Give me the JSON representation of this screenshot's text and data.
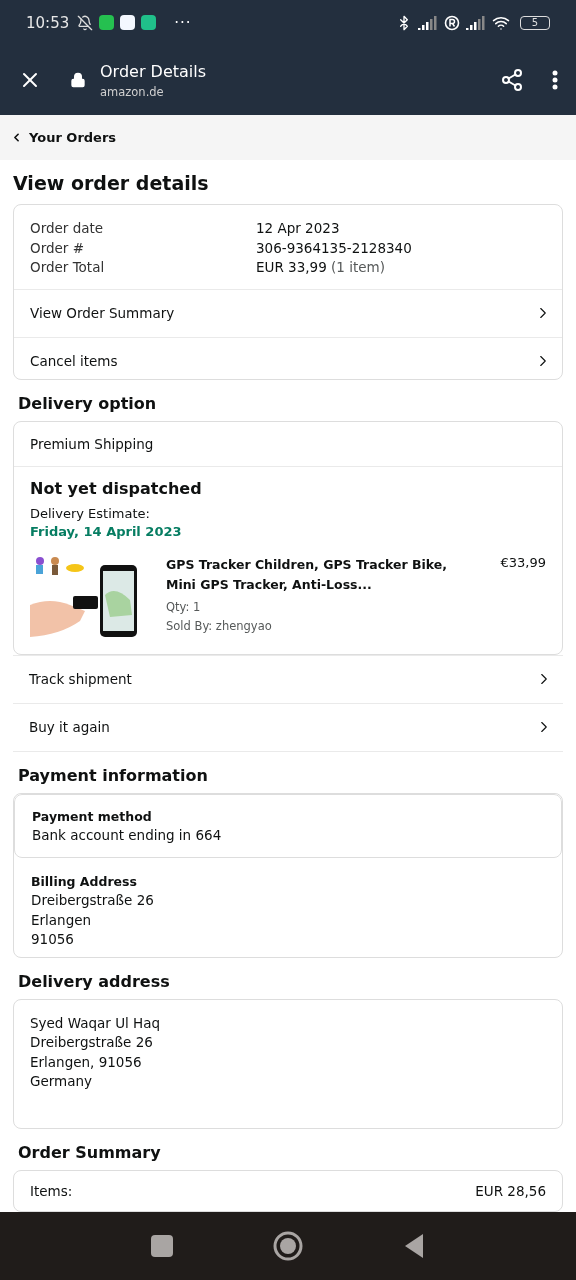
{
  "status_bar": {
    "time": "10:53",
    "more": "···",
    "battery": "5"
  },
  "app_bar": {
    "title": "Order Details",
    "url": "amazon.de"
  },
  "breadcrumb": {
    "label": "Your Orders"
  },
  "page_title": "View order details",
  "order_card": {
    "fields": [
      {
        "label": "Order date",
        "value": "12 Apr 2023"
      },
      {
        "label": "Order #",
        "value": "306-9364135-2128340"
      },
      {
        "label": "Order Total",
        "value": "EUR 33,99",
        "note": "(1 item)"
      }
    ],
    "links": [
      "View Order Summary",
      "Cancel items"
    ]
  },
  "delivery_option": {
    "heading": "Delivery option",
    "shipping": "Premium Shipping",
    "status": "Not yet dispatched",
    "estimate_label": "Delivery Estimate:",
    "estimate_date": "Friday, 14 April 2023",
    "item": {
      "kind": "picture",
      "title": "GPS Tracker Children, GPS Tracker Bike, Mini GPS Tracker, Anti-Loss...",
      "qty": "Qty: 1",
      "seller": "Sold By: zhengyao",
      "price": "€33,99"
    },
    "links": [
      "Track shipment",
      "Buy it again"
    ]
  },
  "payment": {
    "heading": "Payment information",
    "method_label": "Payment method",
    "method": "Bank account ending in 664",
    "billing_label": "Billing Address",
    "billing_lines": [
      "Dreibergstraße 26",
      "Erlangen",
      "91056"
    ]
  },
  "delivery_address": {
    "heading": "Delivery address",
    "lines": [
      "Syed Waqar Ul Haq",
      "Dreibergstraße 26",
      "Erlangen, 91056",
      "Germany"
    ]
  },
  "order_summary": {
    "heading": "Order Summary",
    "rows": [
      {
        "label": "Items:",
        "value": "EUR 28,56"
      }
    ]
  }
}
